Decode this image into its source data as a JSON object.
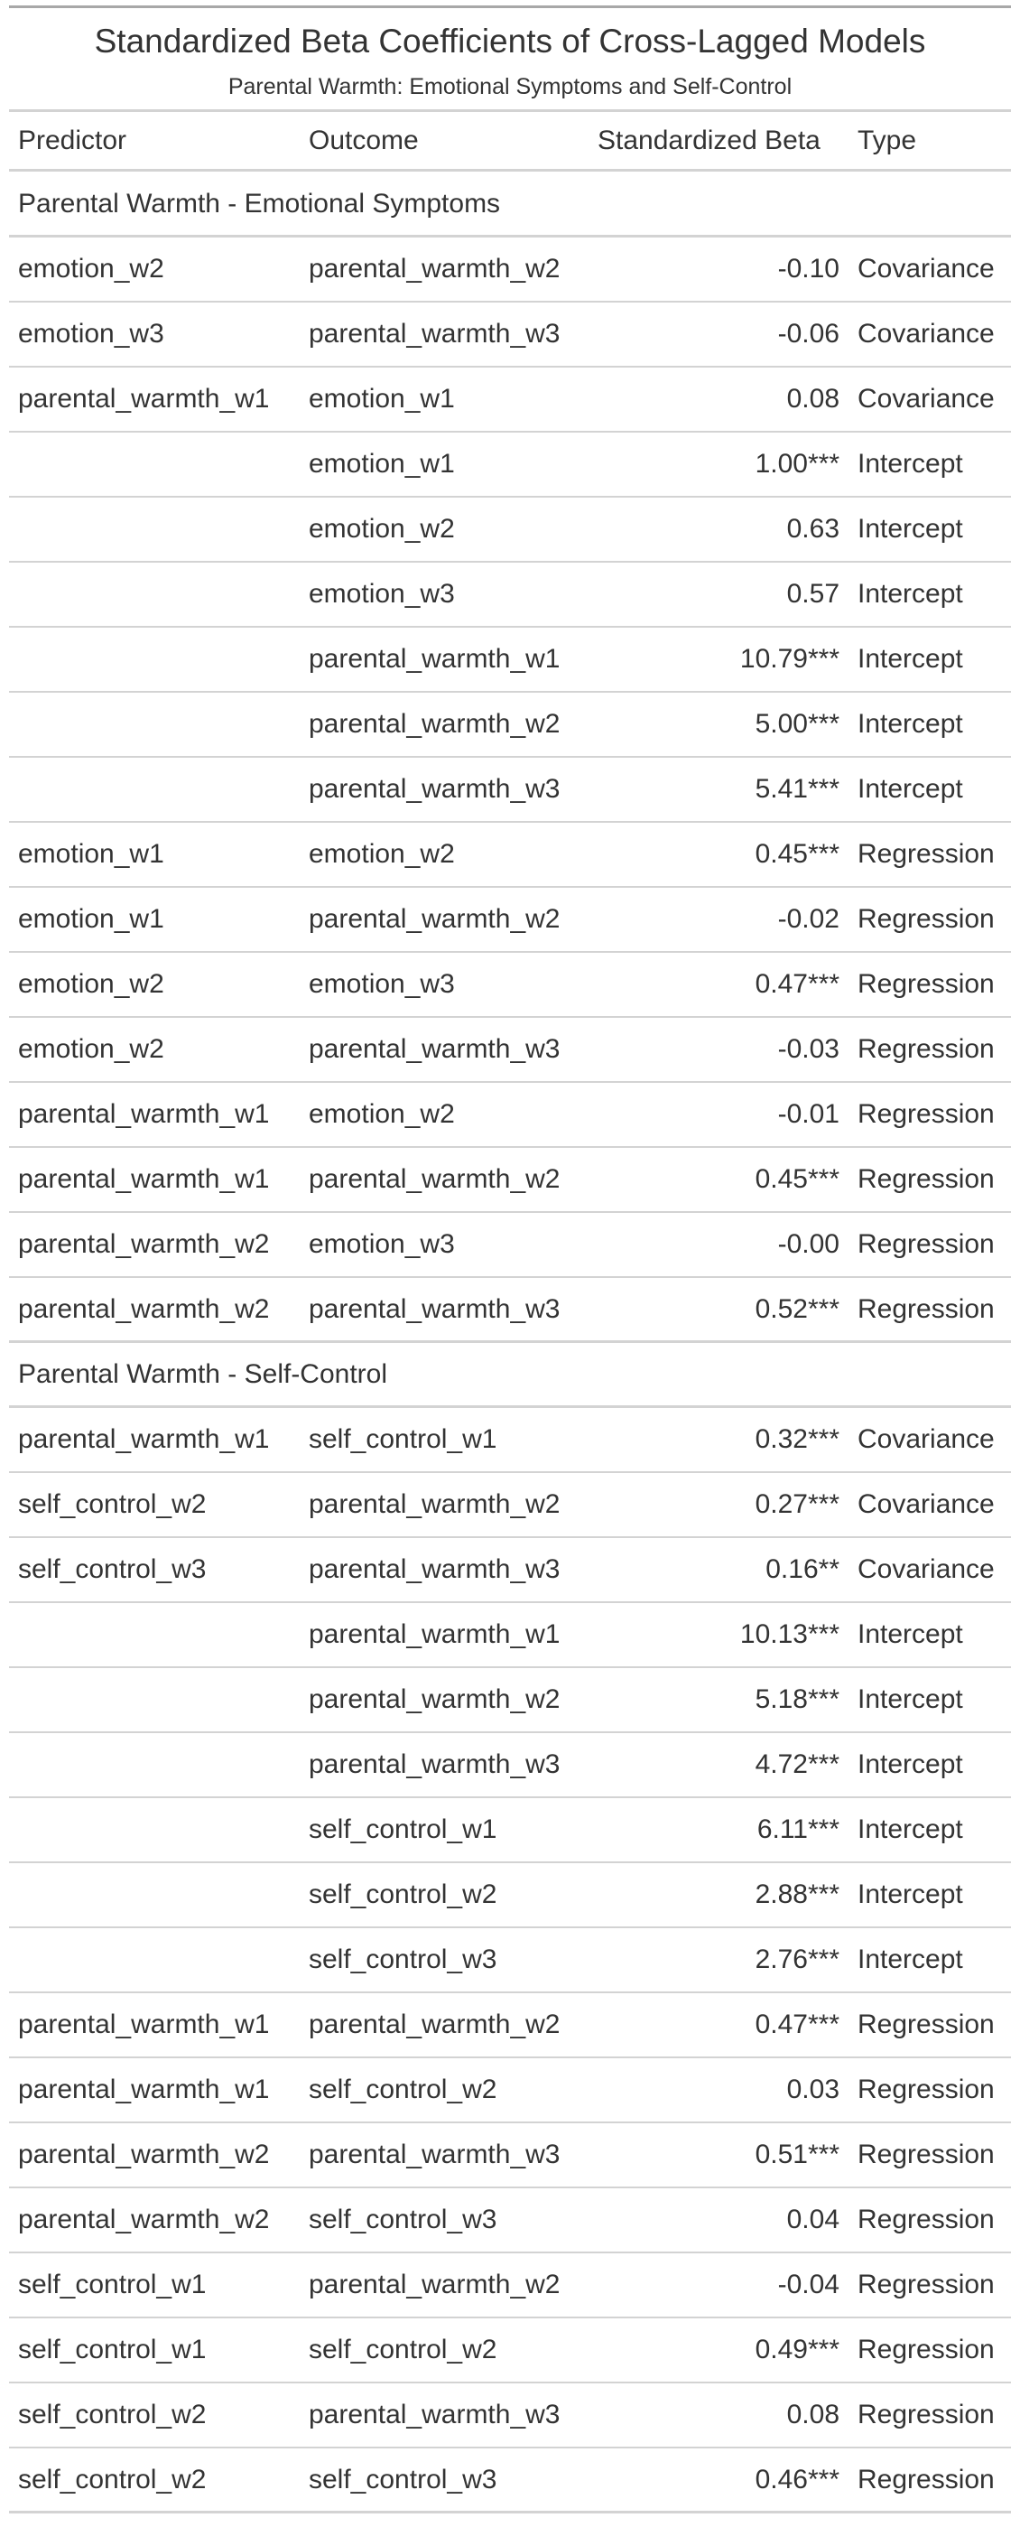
{
  "title": "Standardized Beta Coefficients of Cross-Lagged Models",
  "subtitle": "Parental Warmth: Emotional Symptoms and Self-Control",
  "columns": [
    "Predictor",
    "Outcome",
    "Standardized Beta",
    "Type"
  ],
  "groups": [
    {
      "label": "Parental Warmth - Emotional Symptoms",
      "rows": [
        [
          "emotion_w2",
          "parental_warmth_w2",
          "-0.10",
          "Covariance"
        ],
        [
          "emotion_w3",
          "parental_warmth_w3",
          "-0.06",
          "Covariance"
        ],
        [
          "parental_warmth_w1",
          "emotion_w1",
          "0.08",
          "Covariance"
        ],
        [
          "",
          "emotion_w1",
          "1.00***",
          "Intercept"
        ],
        [
          "",
          "emotion_w2",
          "0.63",
          "Intercept"
        ],
        [
          "",
          "emotion_w3",
          "0.57",
          "Intercept"
        ],
        [
          "",
          "parental_warmth_w1",
          "10.79***",
          "Intercept"
        ],
        [
          "",
          "parental_warmth_w2",
          "5.00***",
          "Intercept"
        ],
        [
          "",
          "parental_warmth_w3",
          "5.41***",
          "Intercept"
        ],
        [
          "emotion_w1",
          "emotion_w2",
          "0.45***",
          "Regression"
        ],
        [
          "emotion_w1",
          "parental_warmth_w2",
          "-0.02",
          "Regression"
        ],
        [
          "emotion_w2",
          "emotion_w3",
          "0.47***",
          "Regression"
        ],
        [
          "emotion_w2",
          "parental_warmth_w3",
          "-0.03",
          "Regression"
        ],
        [
          "parental_warmth_w1",
          "emotion_w2",
          "-0.01",
          "Regression"
        ],
        [
          "parental_warmth_w1",
          "parental_warmth_w2",
          "0.45***",
          "Regression"
        ],
        [
          "parental_warmth_w2",
          "emotion_w3",
          "-0.00",
          "Regression"
        ],
        [
          "parental_warmth_w2",
          "parental_warmth_w3",
          "0.52***",
          "Regression"
        ]
      ]
    },
    {
      "label": "Parental Warmth - Self-Control",
      "rows": [
        [
          "parental_warmth_w1",
          "self_control_w1",
          "0.32***",
          "Covariance"
        ],
        [
          "self_control_w2",
          "parental_warmth_w2",
          "0.27***",
          "Covariance"
        ],
        [
          "self_control_w3",
          "parental_warmth_w3",
          "0.16**",
          "Covariance"
        ],
        [
          "",
          "parental_warmth_w1",
          "10.13***",
          "Intercept"
        ],
        [
          "",
          "parental_warmth_w2",
          "5.18***",
          "Intercept"
        ],
        [
          "",
          "parental_warmth_w3",
          "4.72***",
          "Intercept"
        ],
        [
          "",
          "self_control_w1",
          "6.11***",
          "Intercept"
        ],
        [
          "",
          "self_control_w2",
          "2.88***",
          "Intercept"
        ],
        [
          "",
          "self_control_w3",
          "2.76***",
          "Intercept"
        ],
        [
          "parental_warmth_w1",
          "parental_warmth_w2",
          "0.47***",
          "Regression"
        ],
        [
          "parental_warmth_w1",
          "self_control_w2",
          "0.03",
          "Regression"
        ],
        [
          "parental_warmth_w2",
          "parental_warmth_w3",
          "0.51***",
          "Regression"
        ],
        [
          "parental_warmth_w2",
          "self_control_w3",
          "0.04",
          "Regression"
        ],
        [
          "self_control_w1",
          "parental_warmth_w2",
          "-0.04",
          "Regression"
        ],
        [
          "self_control_w1",
          "self_control_w2",
          "0.49***",
          "Regression"
        ],
        [
          "self_control_w2",
          "parental_warmth_w3",
          "0.08",
          "Regression"
        ],
        [
          "self_control_w2",
          "self_control_w3",
          "0.46***",
          "Regression"
        ]
      ]
    }
  ]
}
